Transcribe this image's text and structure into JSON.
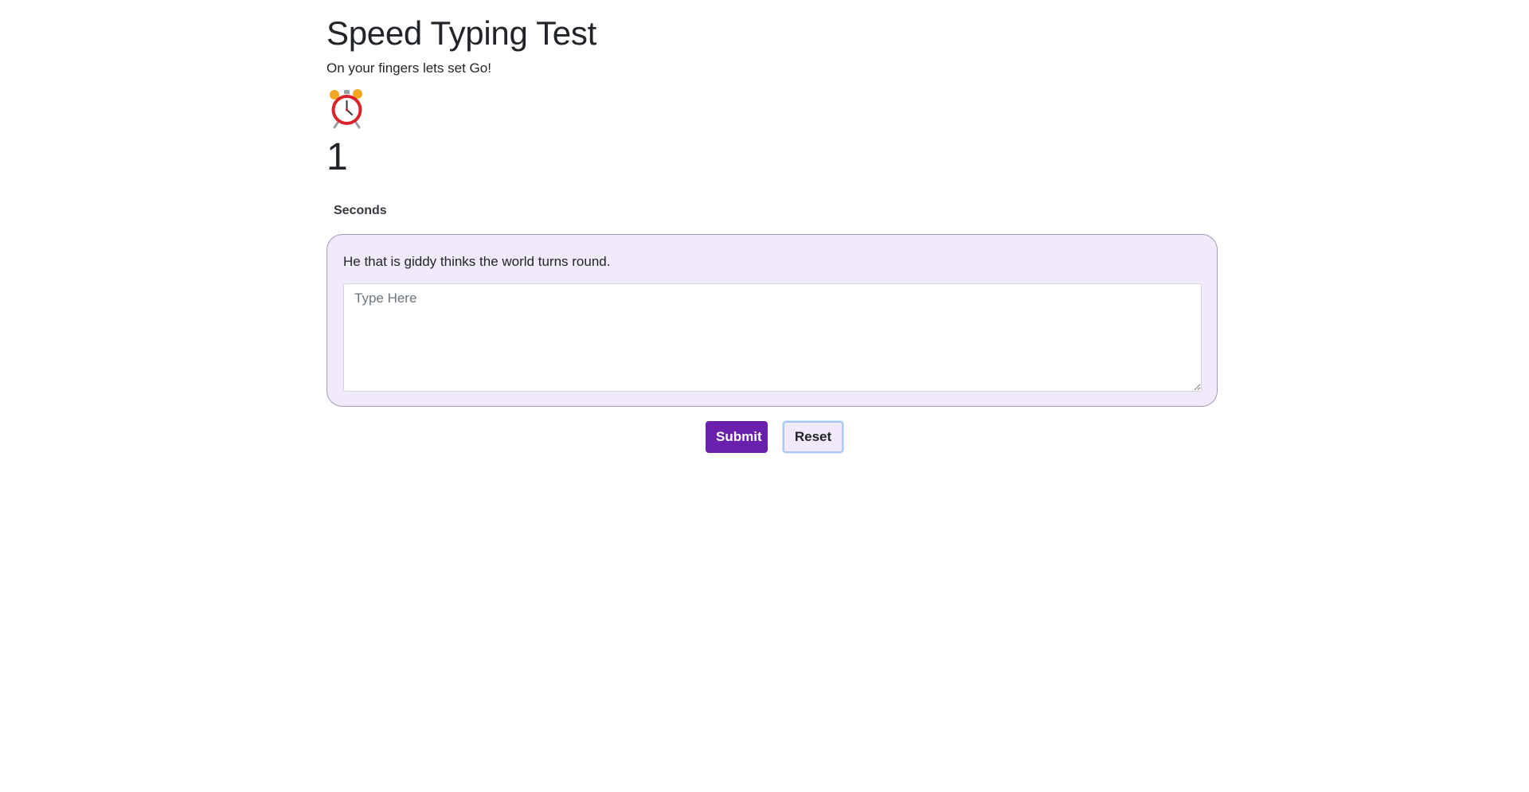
{
  "header": {
    "title": "Speed Typing Test",
    "subtitle": "On your fingers lets set Go!"
  },
  "timer": {
    "icon": "alarm-clock-icon",
    "value": "1",
    "unit": "Seconds"
  },
  "test": {
    "quote": "He that is giddy thinks the world turns round.",
    "input_value": "",
    "input_placeholder": "Type Here"
  },
  "actions": {
    "submit_label": "Submit",
    "reset_label": "Reset"
  },
  "colors": {
    "accent": "#6a1fad",
    "card_background": "#f1eafb",
    "card_border": "#a59ab8",
    "clock_red": "#d8232a",
    "clock_bells": "#f5a623"
  }
}
